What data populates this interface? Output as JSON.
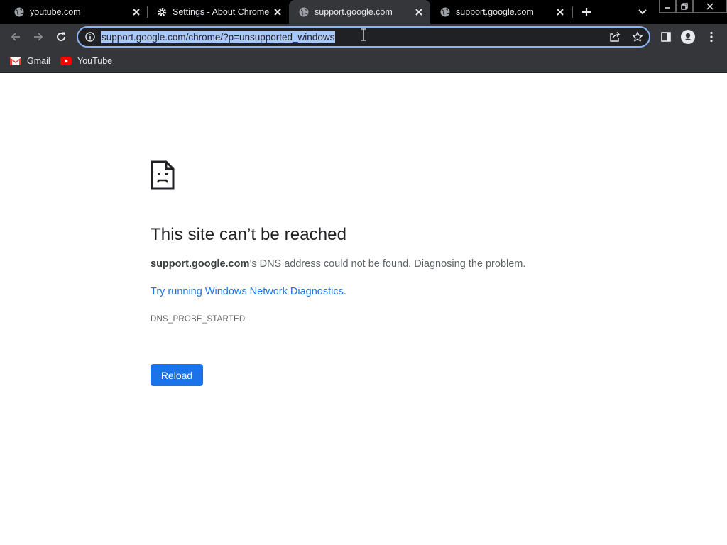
{
  "tabs": [
    {
      "title": "youtube.com",
      "favicon": "globe-icon",
      "active": false
    },
    {
      "title": "Settings - About Chrome",
      "favicon": "gear-icon",
      "active": false
    },
    {
      "title": "support.google.com",
      "favicon": "globe-icon",
      "active": true
    },
    {
      "title": "support.google.com",
      "favicon": "globe-icon",
      "active": false
    }
  ],
  "omnibox": {
    "url": "support.google.com/chrome/?p=unsupported_windows",
    "selected": true
  },
  "bookmarks": [
    {
      "label": "Gmail",
      "icon": "gmail-icon"
    },
    {
      "label": "YouTube",
      "icon": "youtube-icon"
    }
  ],
  "error_page": {
    "heading": "This site can’t be reached",
    "host": "support.google.com",
    "summary_rest": "’s DNS address could not be found. Diagnosing the problem.",
    "link_text": "Try running Windows Network Diagnostics",
    "link_suffix": ".",
    "error_code": "DNS_PROBE_STARTED",
    "reload_label": "Reload"
  },
  "colors": {
    "accent_blue": "#1a73e8",
    "tab_strip": "#000000",
    "toolbar": "#35363a",
    "omnibox_focus": "#8ab4f8",
    "selection": "#a8c7fa"
  }
}
